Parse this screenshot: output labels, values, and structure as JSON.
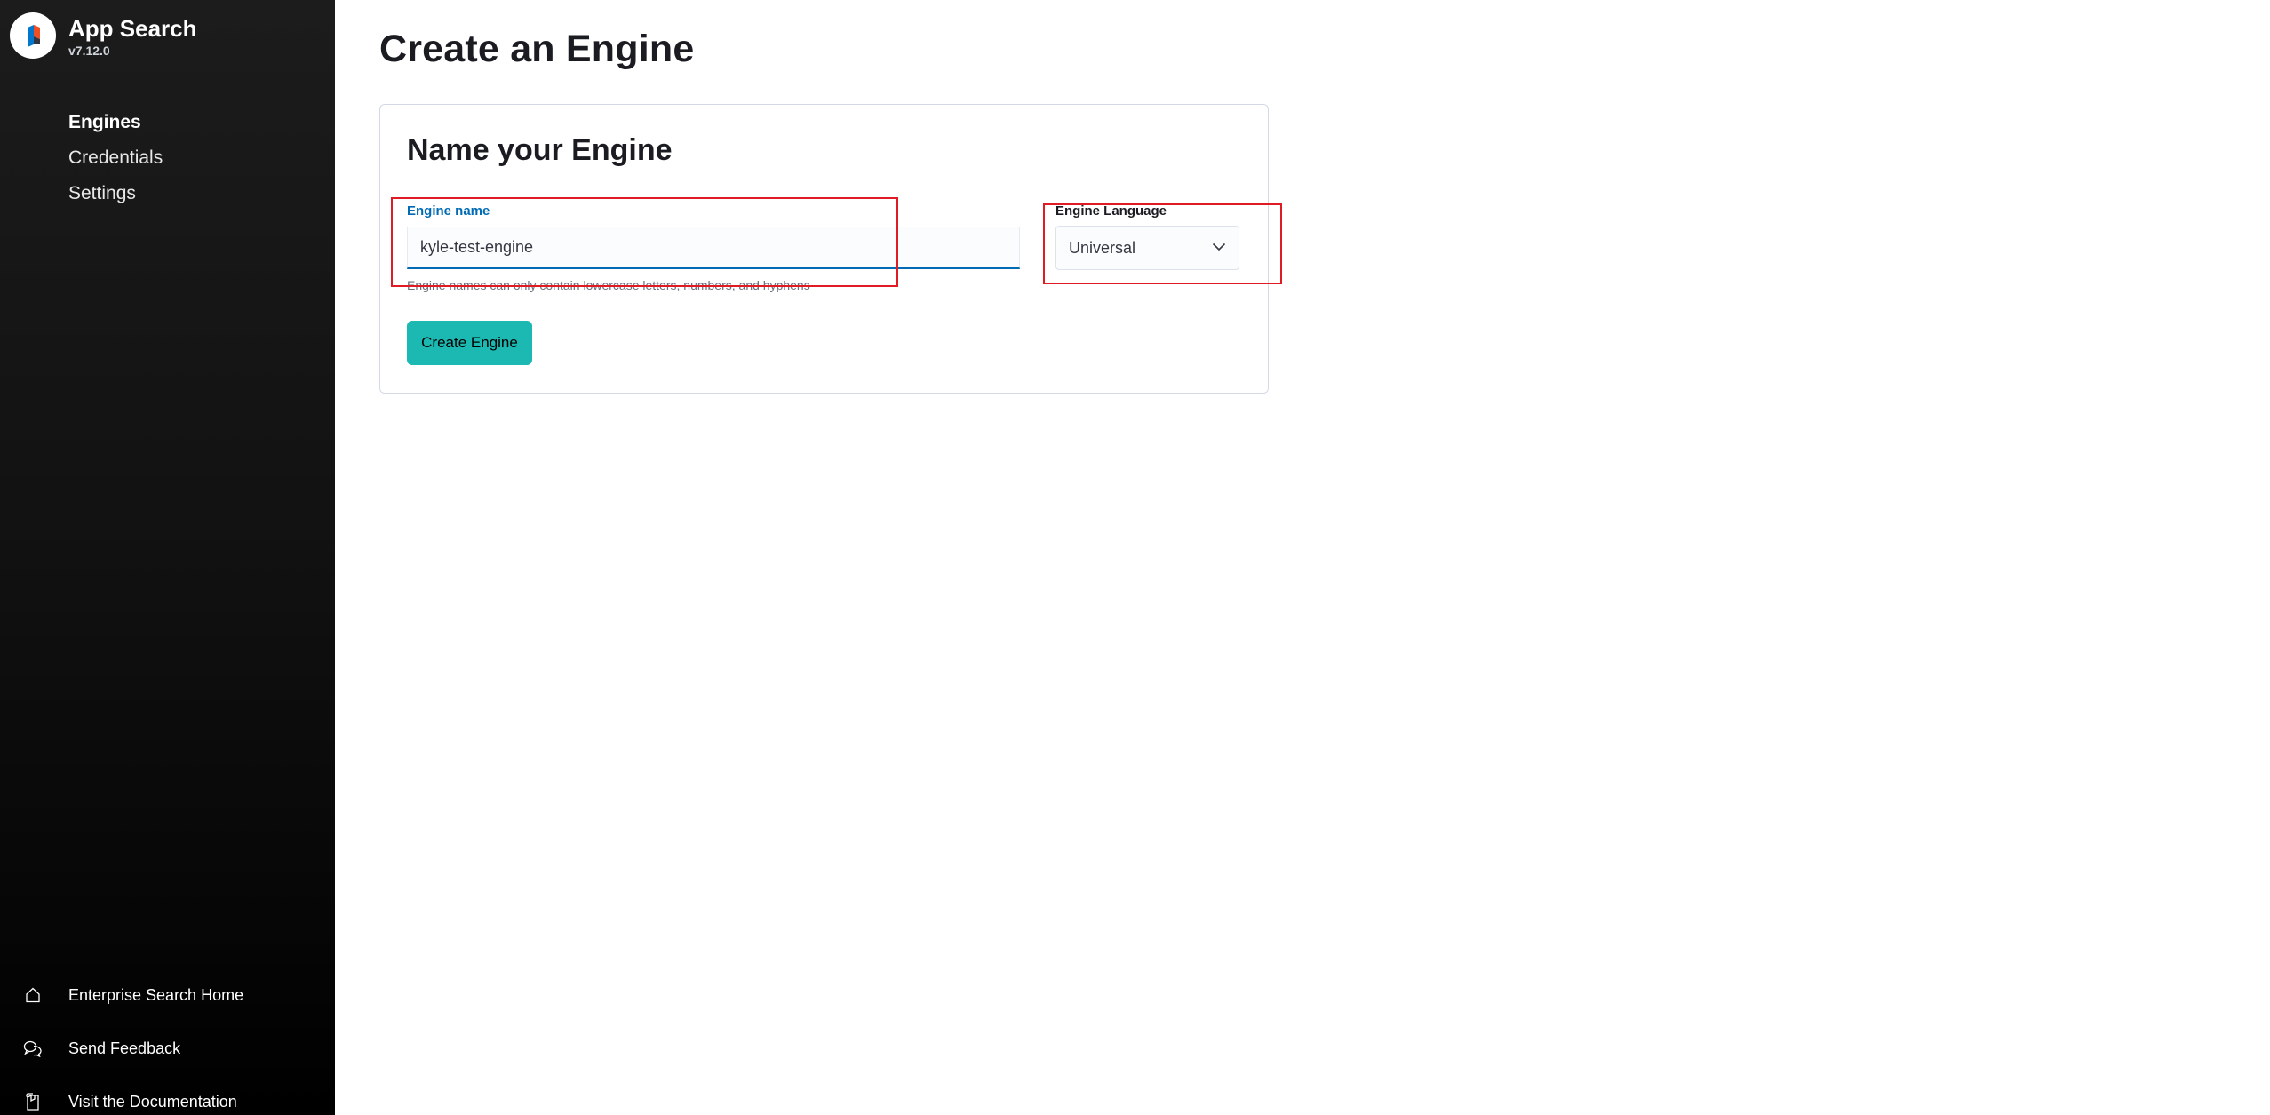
{
  "brand": {
    "title": "App Search",
    "version": "v7.12.0"
  },
  "nav": {
    "items": [
      {
        "label": "Engines",
        "active": true
      },
      {
        "label": "Credentials",
        "active": false
      },
      {
        "label": "Settings",
        "active": false
      }
    ]
  },
  "footer_links": [
    {
      "label": "Enterprise Search Home",
      "icon": "home-icon"
    },
    {
      "label": "Send Feedback",
      "icon": "chat-icon"
    },
    {
      "label": "Visit the Documentation",
      "icon": "documentation-icon"
    }
  ],
  "page": {
    "title": "Create an Engine"
  },
  "form": {
    "heading": "Name your Engine",
    "engine_name": {
      "label": "Engine name",
      "value": "kyle-test-engine",
      "help": "Engine names can only contain lowercase letters, numbers, and hyphens"
    },
    "engine_language": {
      "label": "Engine Language",
      "value": "Universal"
    },
    "submit_label": "Create Engine"
  },
  "colors": {
    "accent": "#006bb4",
    "button": "#1bb9b1",
    "annotation": "#e01b24"
  }
}
